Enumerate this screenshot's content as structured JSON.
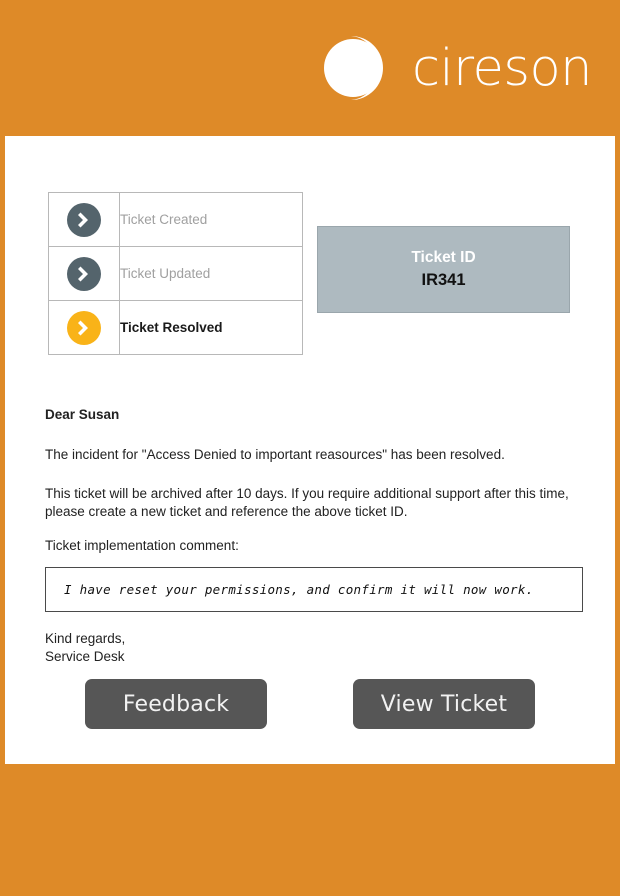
{
  "brand": {
    "name": "cireson",
    "logo_icon": "cireson-circle-logo",
    "header_color": "#DE8A28",
    "logo_color": "#FFFFFF"
  },
  "status_steps": [
    {
      "label": "Ticket Created",
      "icon": "chevron-right-circle-icon",
      "state": "pending",
      "icon_color": "#54646C"
    },
    {
      "label": "Ticket Updated",
      "icon": "chevron-right-circle-icon",
      "state": "pending",
      "icon_color": "#54646C"
    },
    {
      "label": "Ticket Resolved",
      "icon": "chevron-right-circle-icon",
      "state": "active",
      "icon_color": "#F9B318"
    }
  ],
  "ticket_box": {
    "title": "Ticket ID",
    "value": "IR341",
    "background_color": "#AEBAC0"
  },
  "message": {
    "greeting": "Dear Susan",
    "paragraph_1": "The incident for \"Access Denied to important reasources\" has been resolved.",
    "paragraph_2": "This ticket will be archived after 10 days. If you require additional support after this time, please create a new ticket and reference the above ticket ID.",
    "comment_label": "Ticket implementation comment:",
    "comment_text": "I have reset your permissions, and confirm it will now work.",
    "signoff_line_1": "Kind regards,",
    "signoff_line_2": "Service Desk"
  },
  "actions": {
    "feedback_label": "Feedback",
    "view_ticket_label": "View Ticket",
    "button_color": "#565656"
  }
}
